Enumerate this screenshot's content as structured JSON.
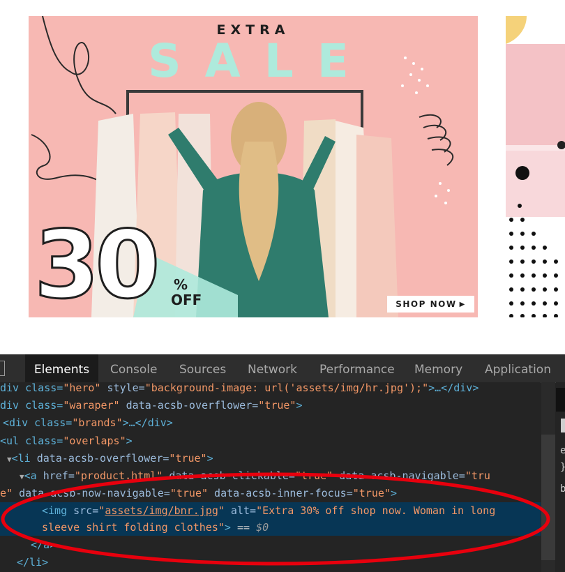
{
  "banner": {
    "extra_text": "EXTRA",
    "sale_text": "SALE",
    "discount_number": "30",
    "percent_sign": "%",
    "off_text": "OFF",
    "shop_now_label": "SHOP NOW",
    "shop_now_arrow": "▶",
    "colors": {
      "background": "#f7b8b3",
      "mint": "#aeeadc",
      "ink": "#1e1e1e"
    }
  },
  "devtools": {
    "tabs": [
      "Elements",
      "Console",
      "Sources",
      "Network",
      "Performance",
      "Memory",
      "Application"
    ],
    "active_tab": "Elements",
    "dom": {
      "l0": {
        "a": "div class=",
        "b": "\"hero\"",
        "c": " style=",
        "d": "\"background-image: url('assets/img/hr.jpg');\"",
        "e": ">…</div>"
      },
      "l1": {
        "a": "div class=",
        "b": "\"waraper\"",
        "c": " data-acsb-overflower=",
        "d": "\"true\"",
        "e": ">"
      },
      "l2": {
        "a": "<div class=",
        "b": "\"brands\"",
        "c": ">…</div>"
      },
      "l3": {
        "a": "<ul class=",
        "b": "\"overlaps\"",
        "c": ">"
      },
      "l4": {
        "tri": "▼",
        "a": "<li",
        "b": " data-acsb-overflower=",
        "c": "\"true\"",
        "d": ">"
      },
      "l5": {
        "tri": "▼",
        "a": "<a",
        "b": " href=",
        "c": "\"product.html\"",
        "d": " data-acsb-clickable=",
        "e": "\"true\"",
        "f": " data-acsb-navigable=",
        "g": "\"tru"
      },
      "l6": {
        "a": "e\"",
        "b": " data-acsb-now-navigable=",
        "c": "\"true\"",
        "d": " data-acsb-inner-focus=",
        "e": "\"true\"",
        "f": ">"
      },
      "l7": {
        "a": "<img",
        "b": " src=",
        "c": "\"",
        "d": "assets/img/bnr.jpg",
        "e": "\"",
        "f": " alt=",
        "g": "\"Extra 30% off shop now. Woman in long"
      },
      "l8": {
        "a": "sleeve shirt folding clothes\"",
        "b": ">",
        "c": " == ",
        "d": "$0"
      },
      "l9": {
        "a": "</a>"
      },
      "l10": {
        "a": "</li>"
      }
    },
    "side_chars": {
      "c1": "e",
      "c2": "}",
      "c3": "b"
    },
    "colors": {
      "background": "#242424",
      "tag": "#5db0d7",
      "attribute": "#9bbbdc",
      "value": "#f29766",
      "selection": "#073655",
      "annotation": "#e8000d"
    }
  }
}
